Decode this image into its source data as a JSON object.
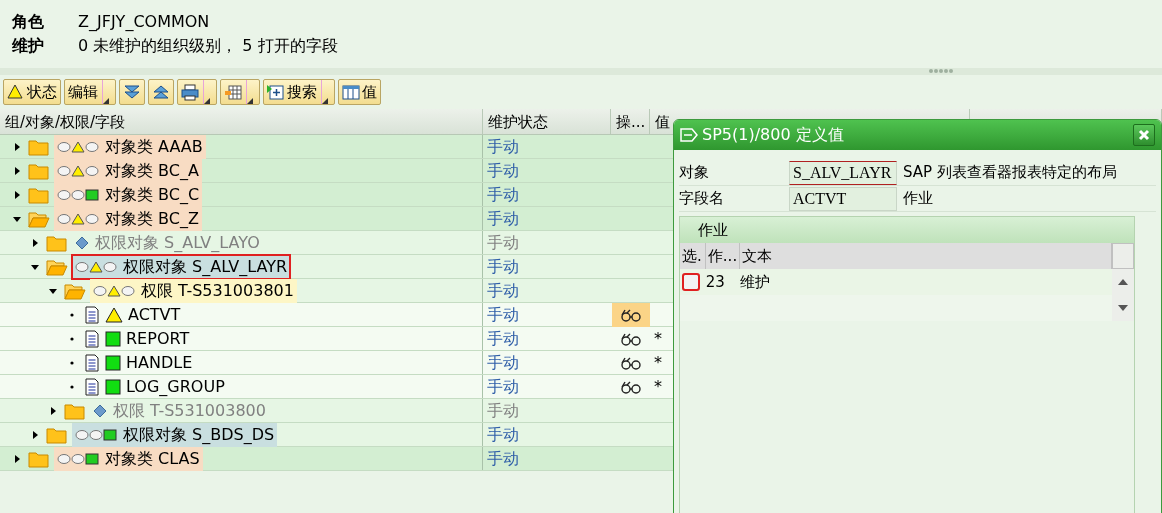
{
  "header": {
    "role_label": "角色",
    "role_value": "Z_JFJY_COMMON",
    "maint_label": "维护",
    "maint_value": "0 未维护的组织级别，  5 打开的字段"
  },
  "toolbar": [
    {
      "kind": "warning",
      "label": "状态",
      "dropdown": false
    },
    {
      "kind": "text",
      "label": "编辑",
      "dropdown": true
    },
    {
      "kind": "collapse",
      "dropdown": false
    },
    {
      "kind": "expand",
      "dropdown": false
    },
    {
      "kind": "print",
      "dropdown": true
    },
    {
      "kind": "grid",
      "dropdown": true
    },
    {
      "kind": "add",
      "label": "搜索",
      "dropdown": true
    },
    {
      "kind": "columns",
      "label": "值",
      "dropdown": false
    }
  ],
  "columns": [
    "组/对象/权限/字段",
    "维护状态",
    "操...",
    "值"
  ],
  "tree": [
    {
      "kind": "class",
      "type": "对象类",
      "name": "AAAB",
      "warning": true,
      "color": "#ffee00",
      "expanded": false,
      "inactive": false,
      "marked": false,
      "maintenance": "手动"
    },
    {
      "kind": "class",
      "type": "对象类",
      "name": "BC_A",
      "warning": true,
      "color": "#ffee00",
      "expanded": false,
      "inactive": false,
      "marked": false,
      "maintenance": "手动"
    },
    {
      "kind": "class",
      "type": "对象类",
      "name": "BC_C",
      "warning": false,
      "color": "#22cc22",
      "expanded": false,
      "inactive": false,
      "marked": false,
      "maintenance": "手动"
    },
    {
      "kind": "class",
      "type": "对象类",
      "name": "BC_Z",
      "warning": true,
      "color": "#ffee00",
      "expanded": true,
      "inactive": false,
      "marked": false,
      "maintenance": "手动",
      "children": [
        {
          "kind": "object",
          "type": "权限对象",
          "name": "S_ALV_LAYO",
          "expanded": false,
          "inactive": true,
          "marked": false,
          "maintenance": "手动"
        },
        {
          "kind": "object",
          "type": "权限对象",
          "name": "S_ALV_LAYR",
          "warning": true,
          "color": "#ffee00",
          "expanded": true,
          "inactive": false,
          "marked": true,
          "maintenance": "手动",
          "children": [
            {
              "kind": "auth",
              "type": "权限",
              "name": "T-S531003801",
              "warning": true,
              "color": "#ffee00",
              "expanded": true,
              "inactive": false,
              "marked": false,
              "maintenance": "手动",
              "children": [
                {
                  "kind": "field",
                  "name": "ACTVT",
                  "warning": true,
                  "color": "#ffee00",
                  "maintenance": "手动",
                  "op_selected": true
                },
                {
                  "kind": "field",
                  "name": "REPORT",
                  "warning": false,
                  "color": "#11dd11",
                  "maintenance": "手动",
                  "op_selected": false,
                  "value": "*"
                },
                {
                  "kind": "field",
                  "name": "HANDLE",
                  "warning": false,
                  "color": "#11dd11",
                  "maintenance": "手动",
                  "op_selected": false,
                  "value": "*"
                },
                {
                  "kind": "field",
                  "name": "LOG_GROUP",
                  "warning": false,
                  "color": "#11dd11",
                  "maintenance": "手动",
                  "op_selected": false,
                  "value": "*"
                }
              ]
            },
            {
              "kind": "auth",
              "type": "权限",
              "name": "T-S531003800",
              "expanded": false,
              "inactive": true,
              "marked": false,
              "maintenance": "手动"
            }
          ]
        },
        {
          "kind": "object",
          "type": "权限对象",
          "name": "S_BDS_DS",
          "warning": false,
          "color": "#22cc22",
          "expanded": false,
          "inactive": false,
          "marked": false,
          "maintenance": "手动"
        }
      ]
    },
    {
      "kind": "class",
      "type": "对象类",
      "name": "CLAS",
      "warning": false,
      "color": "#22cc22",
      "expanded": false,
      "inactive": false,
      "marked": false,
      "maintenance": "手动"
    }
  ],
  "dialog": {
    "title": "SP5(1)/800 定义值",
    "fields": [
      {
        "label": "对象",
        "value": "S_ALV_LAYR",
        "description": "SAP 列表查看器报表特定的布局",
        "focused": true
      },
      {
        "label": "字段名",
        "value": "ACTVT",
        "description": "作业",
        "focused": false
      }
    ],
    "table": {
      "title": "作业",
      "columns": [
        "选.",
        "作...",
        "文本"
      ],
      "rows": [
        {
          "checked": false,
          "marked": true,
          "code": "23",
          "text": "维护"
        }
      ]
    }
  }
}
